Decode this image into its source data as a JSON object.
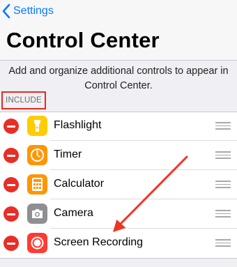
{
  "nav": {
    "back_label": "Settings",
    "title": "Control Center"
  },
  "description": "Add and organize additional controls to appear in Control Center.",
  "section_header": "INCLUDE",
  "colors": {
    "accent": "#0a7aff",
    "delete": "#e82e27",
    "highlight": "#e42a1c",
    "flashlight": "#ffcc00",
    "timer": "#ff9500",
    "calculator": "#ff9500",
    "camera": "#8e8e93",
    "screen_recording": "#ff3b30"
  },
  "controls": [
    {
      "label": "Flashlight",
      "icon": "flashlight-icon"
    },
    {
      "label": "Timer",
      "icon": "timer-icon"
    },
    {
      "label": "Calculator",
      "icon": "calculator-icon"
    },
    {
      "label": "Camera",
      "icon": "camera-icon"
    },
    {
      "label": "Screen Recording",
      "icon": "screen-recording-icon"
    }
  ]
}
